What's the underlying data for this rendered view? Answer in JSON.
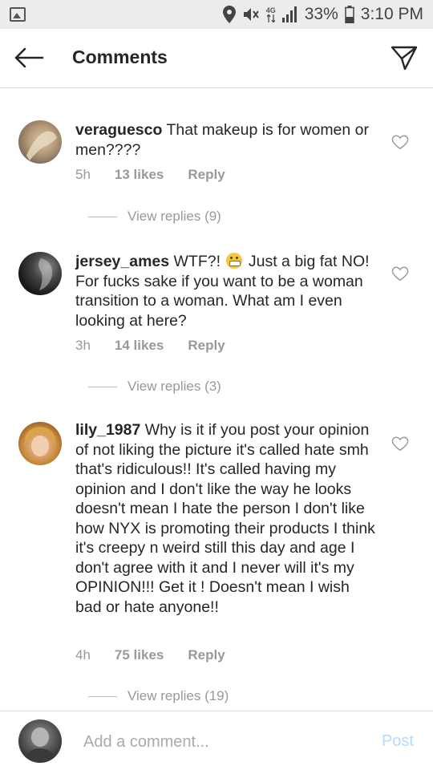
{
  "status_bar": {
    "network_label": "4G",
    "battery_percent": "33%",
    "time": "3:10 PM"
  },
  "header": {
    "title": "Comments"
  },
  "comments": [
    {
      "username": "veraguesco",
      "text": "That makeup is for women or men????",
      "time": "5h",
      "likes": "13 likes",
      "reply": "Reply",
      "view_replies": "View replies (9)"
    },
    {
      "username": "jersey_ames",
      "text_before_emoji": "WTF?!",
      "emoji": "grimacing-face",
      "text_after_emoji": "Just a big fat NO! For fucks sake if you want to be a woman transition to a woman. What am I even looking at here?",
      "time": "3h",
      "likes": "14 likes",
      "reply": "Reply",
      "view_replies": "View replies (3)"
    },
    {
      "username": "lily_1987",
      "text": "Why is it if you post your opinion of not liking the picture it's called hate smh that's ridiculous!! It's called having my opinion and I don't like the way he looks doesn't mean I hate the person I don't like how NYX is promoting their products I think it's creepy n weird still this day and age I don't agree with it and I never will it's my OPINION!!! Get it ! Doesn't mean I wish bad or hate anyone!!",
      "time": "4h",
      "likes": "75 likes",
      "reply": "Reply",
      "view_replies": "View replies (19)"
    }
  ],
  "add_comment": {
    "placeholder": "Add a comment...",
    "post_label": "Post"
  },
  "icons": {
    "status": [
      "gallery-icon",
      "location-icon",
      "mute-icon",
      "signal-icon",
      "battery-icon"
    ],
    "header": [
      "back-arrow-icon",
      "send-icon"
    ],
    "comment": [
      "heart-icon"
    ]
  },
  "colors": {
    "text": "#262626",
    "meta": "#999999",
    "post_disabled": "#b3dbff",
    "status_bar_bg": "#ececec"
  }
}
